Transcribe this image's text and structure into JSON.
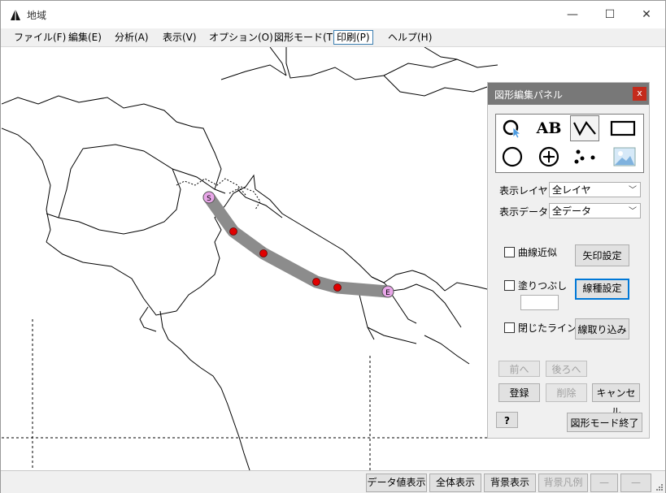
{
  "window": {
    "title": "地域",
    "minimize": "—",
    "maximize": "☐",
    "close": "✕"
  },
  "menu": [
    {
      "label": "ファイル(F)"
    },
    {
      "label": "編集(E)"
    },
    {
      "label": "分析(A)"
    },
    {
      "label": "表示(V)"
    },
    {
      "label": "オプション(O)"
    },
    {
      "label": "図形モード(T)"
    },
    {
      "label": "印刷(P)"
    },
    {
      "label": "ヘルプ(H)"
    }
  ],
  "map": {
    "route_start_marker": "S",
    "route_end_marker": "E",
    "route_color": "#8c8c8c",
    "point_color": "#e00000",
    "marker_color": "#e9a6e9"
  },
  "panel": {
    "title": "図形編集パネル",
    "close_label": "x",
    "tools": [
      {
        "icon": "lasso-pointer-icon"
      },
      {
        "icon": "text-ab-icon",
        "label": "AB"
      },
      {
        "icon": "polyline-icon"
      },
      {
        "icon": "rectangle-icon"
      },
      {
        "icon": "circle-icon"
      },
      {
        "icon": "circle-plus-icon"
      },
      {
        "icon": "scatter-points-icon"
      },
      {
        "icon": "image-icon"
      }
    ],
    "layer_label": "表示レイヤ",
    "layer_value": "全レイヤ",
    "data_label": "表示データ",
    "data_value": "全データ",
    "curve_label": "曲線近似",
    "fill_label": "塗りつぶし",
    "closed_label": "閉じたライン",
    "arrow_btn": "矢印設定",
    "linetype_btn": "線種設定",
    "import_btn": "線取り込み",
    "prev_btn": "前へ",
    "next_btn": "後ろへ",
    "register_btn": "登録",
    "delete_btn": "削除",
    "cancel_btn": "キャンセル",
    "help_btn": "?",
    "end_btn": "図形モード終了"
  },
  "status": {
    "data_value_btn": "データ値表示",
    "full_view_btn": "全体表示",
    "bg_view_btn": "背景表示",
    "bg_legend_btn": "背景凡例",
    "btn5": "—",
    "btn6": "—"
  }
}
